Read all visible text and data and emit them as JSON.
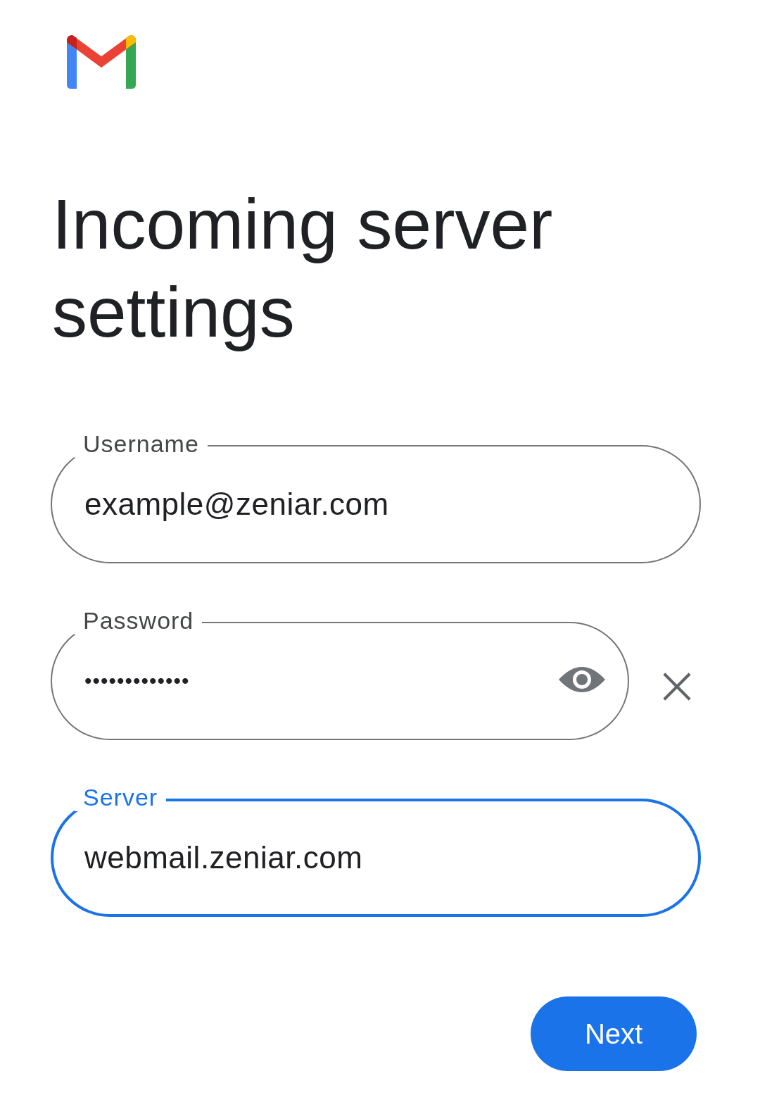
{
  "title": "Incoming server settings",
  "fields": [
    {
      "kind": "text",
      "label": "Username",
      "value": "example@zeniar.com",
      "focused": false
    },
    {
      "kind": "password",
      "label": "Password",
      "value": "•••••••••••••",
      "focused": false
    },
    {
      "kind": "text",
      "label": "Server",
      "value": "webmail.zeniar.com",
      "focused": true
    }
  ],
  "next_button": {
    "label": "Next"
  }
}
